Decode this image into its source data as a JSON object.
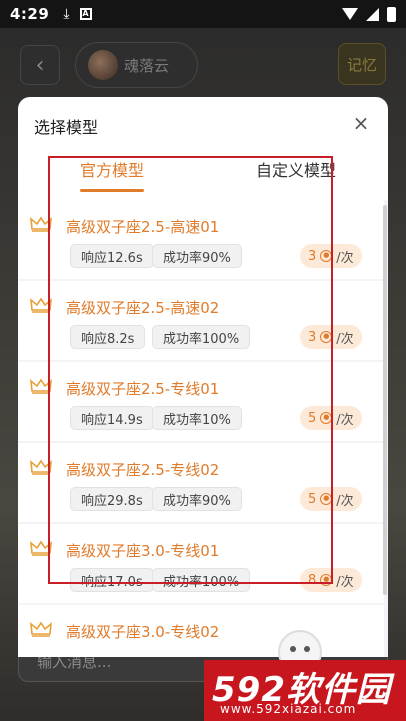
{
  "status_bar": {
    "time": "4:29",
    "notif_letter": "A"
  },
  "topbar": {
    "character_name": "魂落云",
    "memory_label": "记忆"
  },
  "chat": {
    "input_placeholder": "输入消息..."
  },
  "modal": {
    "title": "选择模型",
    "tabs": [
      {
        "label": "官方模型",
        "active": true
      },
      {
        "label": "自定义模型",
        "active": false
      }
    ],
    "models": [
      {
        "name": "高级双子座2.5-高速01",
        "response": "响应12.6s",
        "success_rate": "成功率90%",
        "price": "3",
        "unit": "/次"
      },
      {
        "name": "高级双子座2.5-高速02",
        "response": "响应8.2s",
        "success_rate": "成功率100%",
        "price": "3",
        "unit": "/次"
      },
      {
        "name": "高级双子座2.5-专线01",
        "response": "响应14.9s",
        "success_rate": "成功率10%",
        "price": "5",
        "unit": "/次"
      },
      {
        "name": "高级双子座2.5-专线02",
        "response": "响应29.8s",
        "success_rate": "成功率90%",
        "price": "5",
        "unit": "/次"
      },
      {
        "name": "高级双子座3.0-专线01",
        "response": "响应17.0s",
        "success_rate": "成功率100%",
        "price": "8",
        "unit": "/次"
      },
      {
        "name": "高级双子座3.0-专线02",
        "response": "",
        "success_rate": "",
        "price": "",
        "unit": ""
      }
    ]
  },
  "watermark": {
    "main": "592软件园",
    "sub": "www.592xiazai.com"
  },
  "colors": {
    "accent": "#e07b2a",
    "price_bg": "#fde9d8",
    "highlight_box": "#c81e28"
  }
}
